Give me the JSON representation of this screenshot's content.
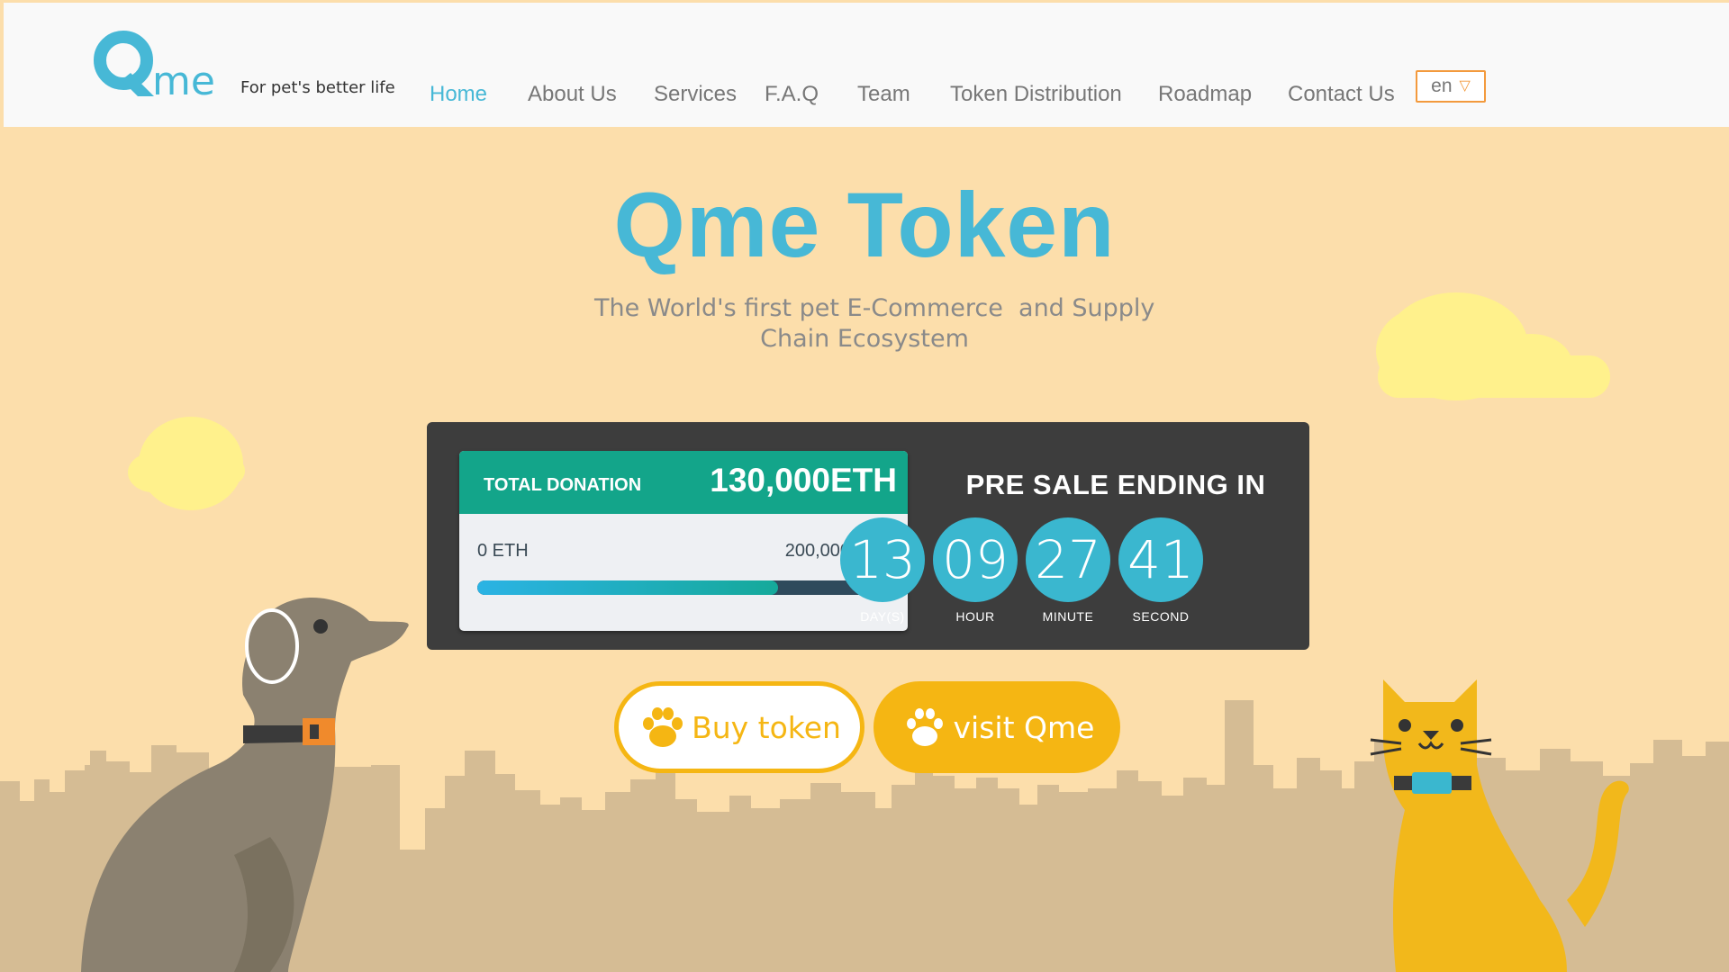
{
  "header": {
    "logo": {
      "mark": "Q",
      "text": "me"
    },
    "tagline": "For pet's better life",
    "nav": [
      {
        "label": "Home",
        "active": true
      },
      {
        "label": "About Us",
        "active": false
      },
      {
        "label": "Services",
        "active": false
      },
      {
        "label": "F.A.Q",
        "active": false
      },
      {
        "label": "Team",
        "active": false
      },
      {
        "label": "Token Distribution",
        "active": false
      },
      {
        "label": "Roadmap",
        "active": false
      },
      {
        "label": "Contact Us",
        "active": false
      }
    ],
    "language": {
      "value": "en",
      "icon": "triangle-down-icon"
    }
  },
  "hero": {
    "title": "Qme Token",
    "subtitle_line1": "The World's first pet E-Commerce  and Supply",
    "subtitle_line2": "Chain Ecosystem"
  },
  "donation": {
    "label": "TOTAL DONATION",
    "total": "130,000ETH",
    "min_label": "0 ETH",
    "max_label": "200,000ETH",
    "progress_fraction": 0.73
  },
  "presale": {
    "title": "PRE SALE ENDING IN",
    "countdown": [
      {
        "value": "13",
        "label": "DAY(S)"
      },
      {
        "value": "09",
        "label": "HOUR"
      },
      {
        "value": "27",
        "label": "MINUTE"
      },
      {
        "value": "41",
        "label": "SECOND"
      }
    ]
  },
  "buttons": {
    "buy": "Buy token",
    "visit": "visit Qme"
  },
  "colors": {
    "background": "#fcdeab",
    "accent_blue": "#47b8d6",
    "accent_yellow": "#f5b613",
    "panel": "#3d3d3d",
    "donation_green": "#13a58a",
    "countdown_circle": "#3ab7cf",
    "skyline": "#d5bc94",
    "dog": "#8b8170",
    "cat": "#f2b81b"
  }
}
